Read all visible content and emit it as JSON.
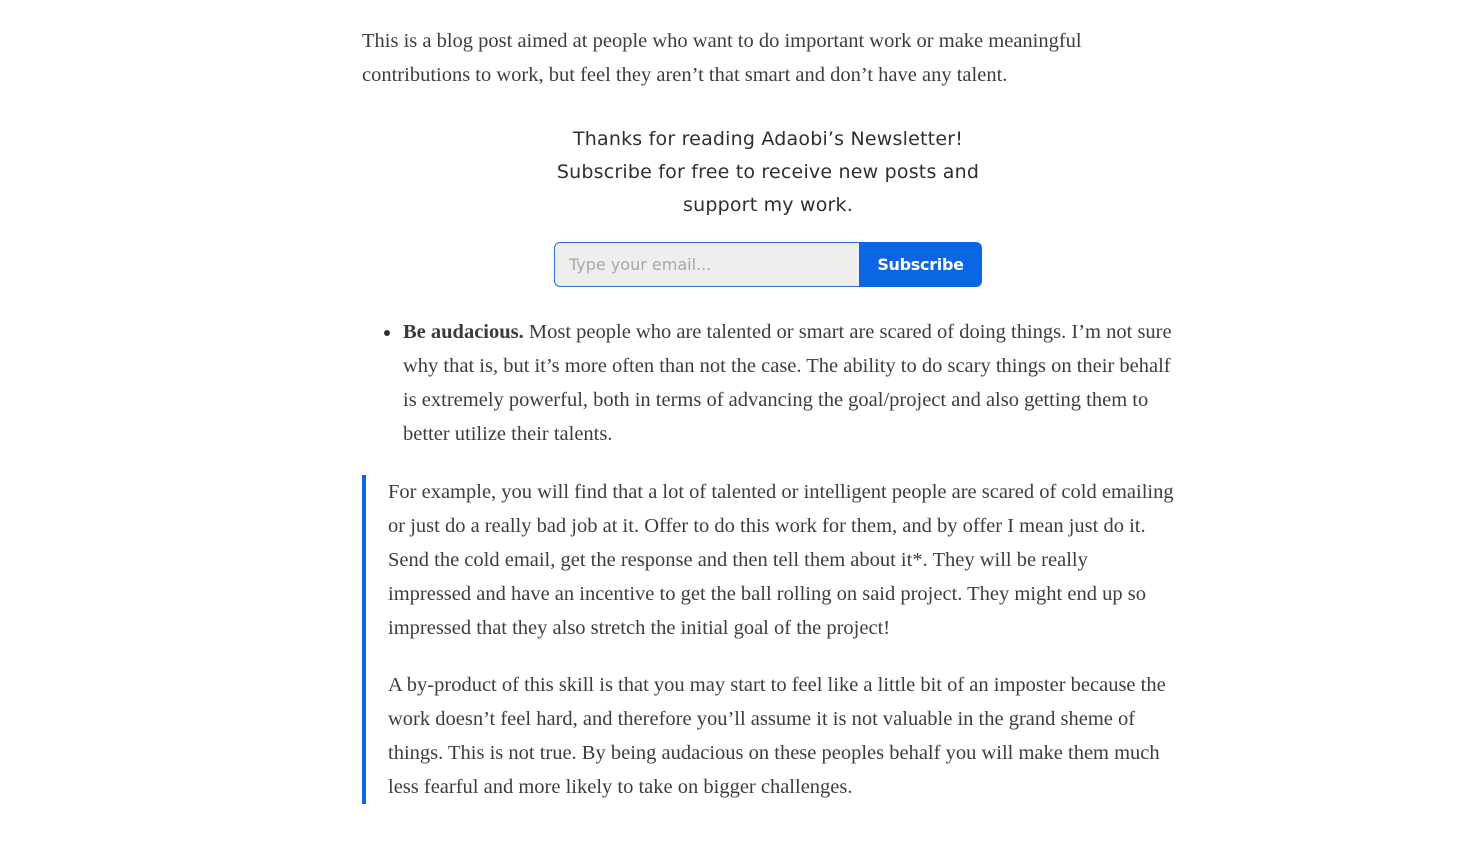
{
  "intro": {
    "text": "This is a blog post aimed at people who want to do important work or make meaningful contributions to work, but feel they aren’t that smart and don’t have any talent."
  },
  "subscribe": {
    "message": "Thanks for reading Adaobi’s Newsletter! Subscribe for free to receive new posts and support my work.",
    "email_placeholder": "Type your email...",
    "email_value": "",
    "button_label": "Subscribe",
    "accent_color": "#0a66e4"
  },
  "list": {
    "items": [
      {
        "lead": "Be audacious.",
        "text": " Most people who are talented or smart are scared of doing things. I’m not sure why that is, but it’s more often than not the case. The ability to do scary things on their behalf is extremely powerful, both in terms of advancing the goal/project and also getting them to better utilize their talents."
      }
    ]
  },
  "quote": {
    "paragraphs": [
      "For example, you will find that a lot of talented or intelligent people are scared of cold emailing or just do a really bad job at it. Offer to do this work for them, and by offer I mean just do it. Send the cold email, get the response and then tell them about it*. They will be really impressed and have an incentive to get the ball rolling on said project. They might end up so impressed that they also stretch the initial goal of the project!",
      "A by-product of this skill is that you may start to feel like a little bit of an imposter because the work doesn’t feel hard, and therefore you’ll assume it is not valuable in the grand sheme of things. This is not true. By being audacious on these peoples behalf you will make them much less fearful and more likely to take on bigger challenges."
    ]
  }
}
